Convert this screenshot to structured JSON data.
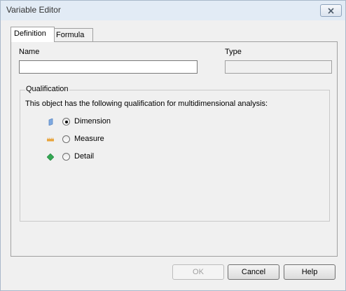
{
  "window": {
    "title": "Variable Editor"
  },
  "tabs": [
    {
      "label": "Definition",
      "active": true
    },
    {
      "label": "Formula",
      "active": false
    }
  ],
  "definition": {
    "name_label": "Name",
    "name_value": "",
    "type_label": "Type",
    "type_value": ""
  },
  "qualification": {
    "legend": "Qualification",
    "description": "This object has the following qualification for multidimensional analysis:",
    "selected": "Dimension",
    "options": [
      {
        "label": "Dimension",
        "icon": "dimension-icon",
        "color": "#7fa9e0"
      },
      {
        "label": "Measure",
        "icon": "measure-icon",
        "color": "#e8a33a"
      },
      {
        "label": "Detail",
        "icon": "detail-icon",
        "color": "#34a853"
      }
    ]
  },
  "buttons": {
    "ok": "OK",
    "cancel": "Cancel",
    "help": "Help"
  }
}
